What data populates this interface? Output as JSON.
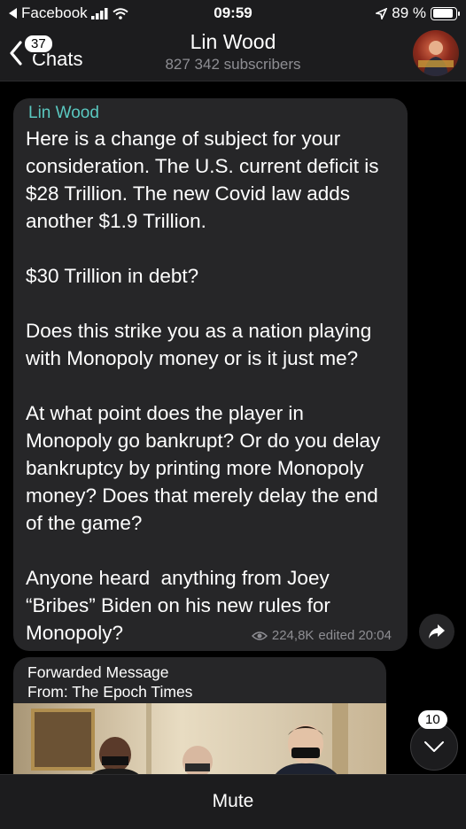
{
  "status_bar": {
    "back_app": "Facebook",
    "time": "09:59",
    "battery": "89 %",
    "battery_level": 0.89
  },
  "header": {
    "back_label": "Chats",
    "unread_badge": "37",
    "channel_name": "Lin Wood",
    "subscribers": "827 342 subscribers"
  },
  "message": {
    "sender": "Lin Wood",
    "text": "Here is a change of subject for your consideration. The U.S. current deficit is $28 Trillion. The new Covid law adds another $1.9 Trillion.\n\n$30 Trillion in debt?\n\nDoes this strike you as a nation playing with Monopoly money or is it just me?\n\nAt what point does the player in Monopoly go bankrupt? Or do you delay bankruptcy by printing more Monopoly money? Does that merely delay the end of the game?\n\nAnyone heard  anything from Joey “Bribes” Biden on his new rules for Monopoly?",
    "views": "224,8K",
    "edited_time": "edited 20:04"
  },
  "forwarded": {
    "label": "Forwarded Message",
    "from_prefix": "From: ",
    "from_name": "The Epoch Times"
  },
  "scroll_down": {
    "unread_count": "10"
  },
  "footer": {
    "mute_label": "Mute"
  },
  "colors": {
    "background": "#000000",
    "bar": "#1c1c1e",
    "bubble": "#262628",
    "sender_accent": "#5ac8c0",
    "secondary_text": "#8e8e93"
  }
}
